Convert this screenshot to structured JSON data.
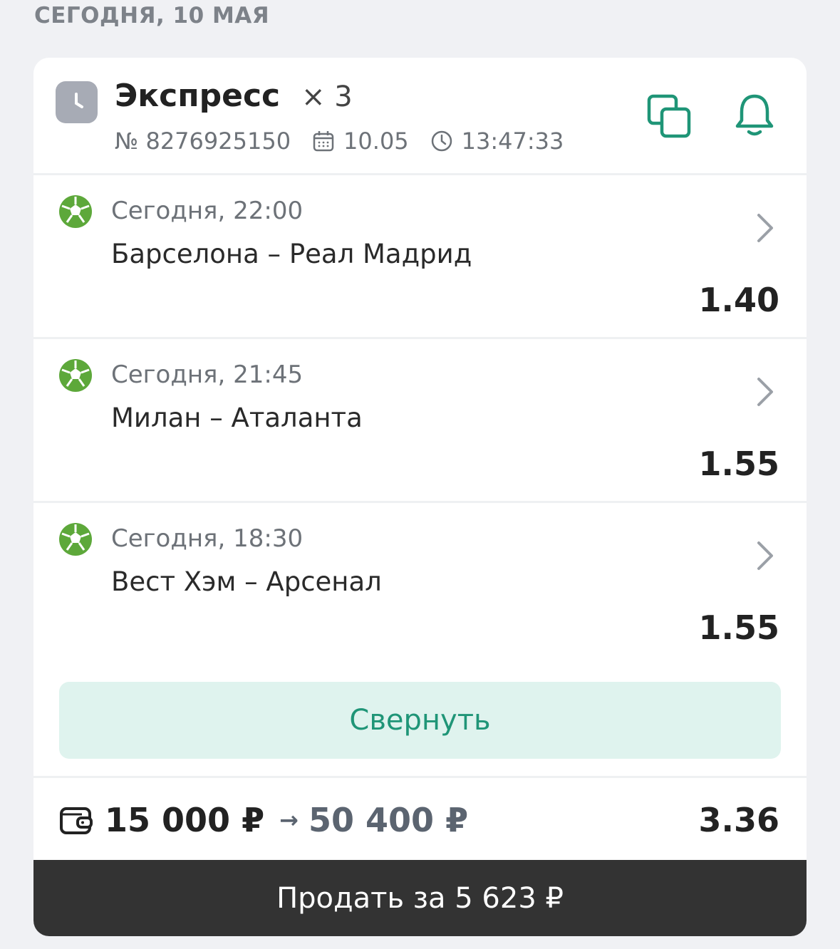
{
  "date_header": "СЕГОДНЯ, 10 МАЯ",
  "bet": {
    "title": "Экспресс",
    "multiplier": "× 3",
    "number": "№ 8276925150",
    "date": "10.05",
    "time": "13:47:33"
  },
  "events": [
    {
      "time": "Сегодня, 22:00",
      "name": "Барселона – Реал Мадрид",
      "odds": "1.40"
    },
    {
      "time": "Сегодня, 21:45",
      "name": "Милан – Аталанта",
      "odds": "1.55"
    },
    {
      "time": "Сегодня, 18:30",
      "name": "Вест Хэм – Арсенал",
      "odds": "1.55"
    }
  ],
  "collapse_label": "Свернуть",
  "summary": {
    "stake": "15 000 ₽",
    "arrow": "→",
    "payout": "50 400 ₽",
    "total_odds": "3.36"
  },
  "sell_label": "Продать за 5 623 ₽",
  "colors": {
    "accent": "#1f9577",
    "ball": "#5da83a",
    "sell_bg": "#333333",
    "collapse_bg": "#dff3ee"
  }
}
